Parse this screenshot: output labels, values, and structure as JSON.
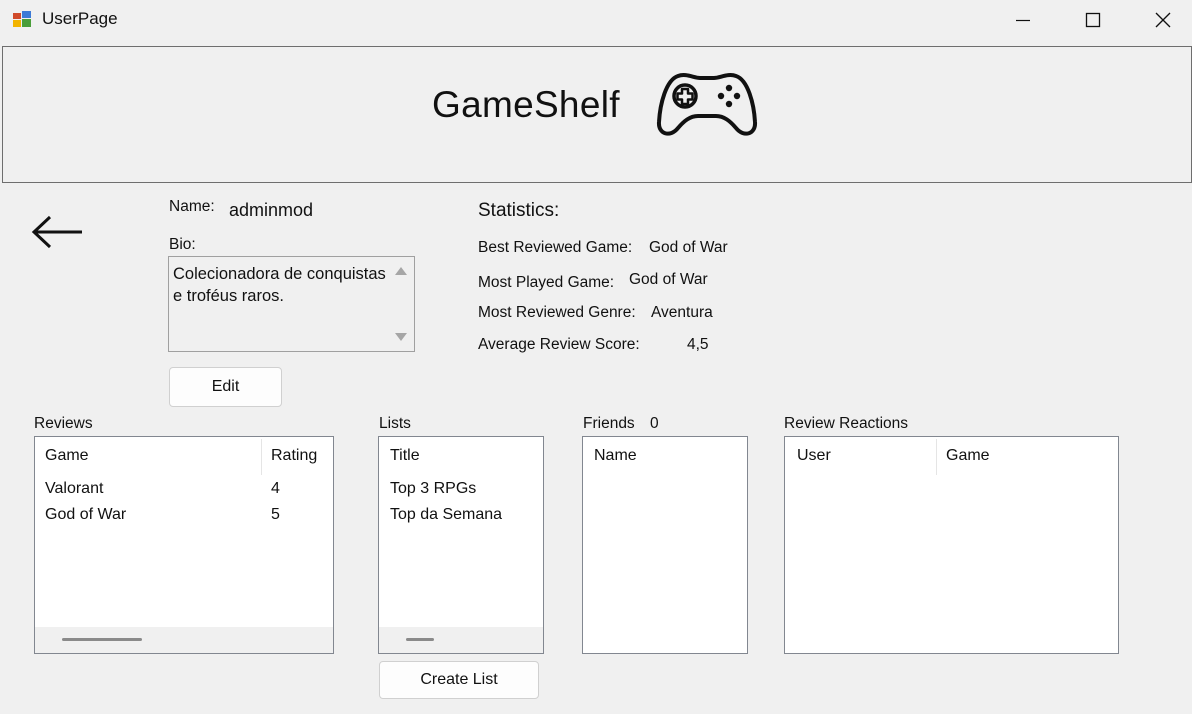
{
  "window": {
    "title": "UserPage",
    "icon": "app-icon"
  },
  "header": {
    "brand": "GameShelf",
    "logo_icon": "gamepad-icon"
  },
  "profile": {
    "name_label": "Name:",
    "name_value": "adminmod",
    "bio_label": "Bio:",
    "bio_value": "Colecionadora de conquistas e troféus raros.",
    "edit_label": "Edit"
  },
  "statistics": {
    "title": "Statistics:",
    "best_reviewed_label": "Best Reviewed Game:",
    "best_reviewed_value": "God of War",
    "most_played_label": "Most Played Game:",
    "most_played_value": "God of War",
    "most_reviewed_genre_label": "Most Reviewed Genre:",
    "most_reviewed_genre_value": "Aventura",
    "avg_score_label": "Average Review Score:",
    "avg_score_value": "4,5"
  },
  "reviews": {
    "label": "Reviews",
    "columns": [
      "Game",
      "Rating"
    ],
    "rows": [
      [
        "Valorant",
        "4"
      ],
      [
        "God of War",
        "5"
      ]
    ]
  },
  "lists": {
    "label": "Lists",
    "columns": [
      "Title"
    ],
    "rows": [
      "Top 3 RPGs",
      "Top da Semana"
    ],
    "create_label": "Create List"
  },
  "friends": {
    "label": "Friends",
    "count": "0",
    "columns": [
      "Name"
    ]
  },
  "review_reactions": {
    "label": "Review Reactions",
    "columns": [
      "User",
      "Game"
    ]
  }
}
